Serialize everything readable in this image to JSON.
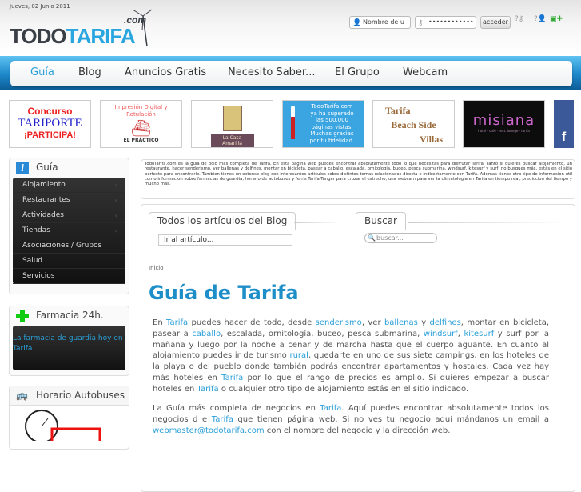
{
  "header": {
    "date": "Jueves, 02 Junio 2011",
    "logo": {
      "part1": "TODO",
      "part2": "TARIFA",
      "suffix": ".com"
    },
    "login": {
      "username_placeholder": "Nombre de u",
      "password_value": "••••••••••••",
      "submit_label": "acceder"
    }
  },
  "nav": {
    "items": [
      "Guía",
      "Blog",
      "Anuncios Gratis",
      "Necesito Saber...",
      "El Grupo",
      "Webcam"
    ],
    "active": "Guía"
  },
  "banners": [
    {
      "name": "concurso-tariporte",
      "lines": [
        "Concurso",
        "TARIPORTE",
        "¡PARTICIPA!"
      ]
    },
    {
      "name": "el-practico",
      "lines": [
        "Impresión Digital y Rotulación",
        "EL PRÁCTICO"
      ]
    },
    {
      "name": "la-casa-amarilla",
      "lines": [
        "La Casa Amarilla"
      ]
    },
    {
      "name": "visits-milestone",
      "lines": [
        "TodoTarifa.com",
        "ya ha superado",
        "las 500.000",
        "páginas vistas.",
        "Muchas gracias",
        "por tu fidelidad."
      ]
    },
    {
      "name": "tarifa-beach-side-villas",
      "lines": [
        "Tarifa",
        "Beach Side",
        "Villas"
      ]
    },
    {
      "name": "misiana",
      "lines": [
        "misiana",
        "hotel · café · rest. lounge · tarifa"
      ]
    },
    {
      "name": "facebook",
      "lines": [
        "f"
      ]
    }
  ],
  "sidebar": {
    "guia": {
      "title": "Guía",
      "items": [
        {
          "label": "Alojamiento",
          "sub": true
        },
        {
          "label": "Restaurantes",
          "sub": true
        },
        {
          "label": "Actividades",
          "sub": true
        },
        {
          "label": "Tiendas",
          "sub": true
        },
        {
          "label": "Asociaciones / Grupos",
          "sub": false
        },
        {
          "label": "Salud",
          "sub": false
        },
        {
          "label": "Servicios",
          "sub": false
        }
      ]
    },
    "farmacia": {
      "title": "Farmacia 24h.",
      "link": "La farmacia de guardia hoy en Tarifa"
    },
    "autobuses": {
      "title": "Horario Autobuses"
    }
  },
  "intro": "TodoTarifa.com es la guia de ocio más completa de Tarifa. En esta pagina web puedes encontrar absolutamente todo lo que necesitas para disfrutar Tarifa. Tanto si quieres buscar alojamiento, un restaurante, hacer senderismo, ver ballenas y delfines, montar en bicicleta, pasear a caballo, escalada, ornitologia, buceo, pesca submarina, windsurf, kitesurf y surf, no busques más, estás en el sitio perfecto para encontrarlo. Tambien tienes un extenso blog con interesantes articulos sobre distintos temas relacionados directa e indirectamente con Tarifa. Ademas tienes otro tipo de informacion util como informacion sobre farmacias de guardia, horario de autobuses y ferris Tarifa-Tanger para cruzar el estrecho, una webcam para ver la climatologia en Tarifa en tiempo real, prediccion del tiempo y mucho más.",
  "blog": {
    "tab": "Todos los artículos del Blog",
    "select": "Ir al artículo..."
  },
  "search": {
    "tab": "Buscar",
    "placeholder": "buscar..."
  },
  "breadcrumb": "Inicio",
  "title": "Guía de Tarifa",
  "paragraphs": [
    [
      [
        "En ",
        0
      ],
      [
        "Tarifa",
        1
      ],
      [
        " puedes hacer de todo, desde ",
        0
      ],
      [
        "senderismo",
        1
      ],
      [
        ", ver ",
        0
      ],
      [
        "ballenas",
        1
      ],
      [
        " y ",
        0
      ],
      [
        "delfines",
        1
      ],
      [
        ", montar en bicicleta, pasear a ",
        0
      ],
      [
        "caballo",
        1
      ],
      [
        ", escalada, ornitología, buceo, pesca submarina, ",
        0
      ],
      [
        "windsurf",
        1
      ],
      [
        ", ",
        0
      ],
      [
        "kitesurf",
        1
      ],
      [
        " y surf por la mañana y luego por la noche a cenar y de marcha hasta que el cuerpo aguante. En cuanto al alojamiento puedes ir de turismo ",
        0
      ],
      [
        "rural",
        1
      ],
      [
        ", quedarte en uno de sus siete campings, en los hoteles de la playa o del pueblo donde también podrás encontrar apartamentos y hostales. Cada vez hay más hoteles en ",
        0
      ],
      [
        "Tarifa",
        1
      ],
      [
        " por lo que el rango de precios es amplio. Si quieres empezar a buscar hoteles en ",
        0
      ],
      [
        "Tarifa",
        1
      ],
      [
        " o cualquier otro tipo de alojamiento estás en el sitio indicado.",
        0
      ]
    ],
    [
      [
        "La Guía más completa de negocios en ",
        0
      ],
      [
        "Tarifa",
        1
      ],
      [
        ". Aquí puedes encontrar absolutamente todos los negocios d e ",
        0
      ],
      [
        "Tarifa",
        1
      ],
      [
        " que tienen página web. Si no ves tu negocio aquí mándanos un email a ",
        0
      ],
      [
        "webmaster@todotarifa.com",
        1
      ],
      [
        " con el nombre del negocio y la dirección web.",
        0
      ]
    ]
  ],
  "colors": {
    "accent": "#2a9fd8",
    "band": "#1d87c9",
    "title": "#1e8ec8"
  }
}
